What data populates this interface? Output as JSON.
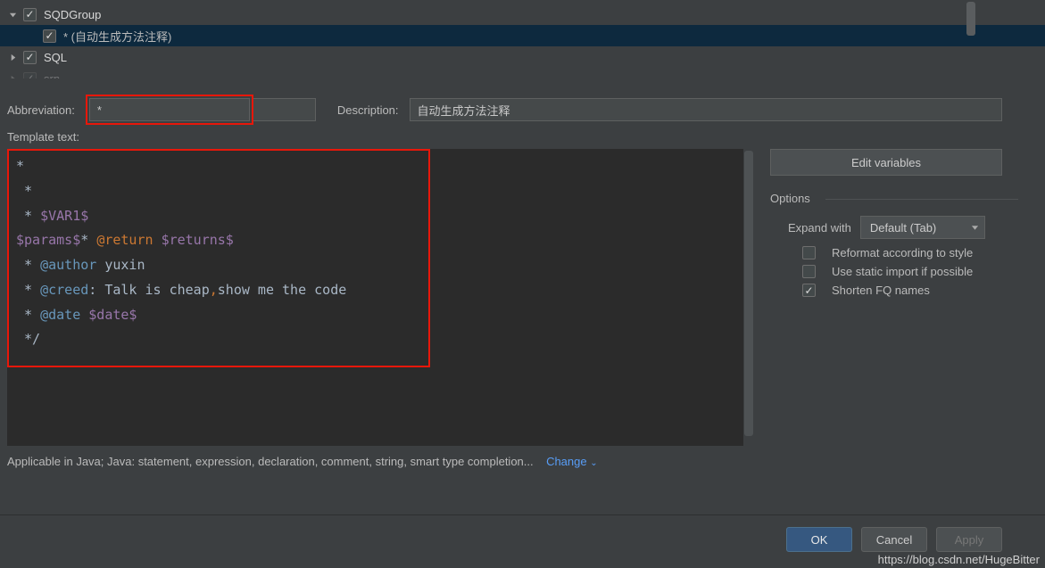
{
  "tree": {
    "group": "SQDGroup",
    "child": "* (自动生成方法注释)",
    "next": "SQL",
    "partial": "srn"
  },
  "form": {
    "abbrev_label": "Abbreviation:",
    "abbrev_value": "*",
    "desc_label": "Description:",
    "desc_value": "自动生成方法注释",
    "template_label": "Template text:"
  },
  "code": {
    "l1": "*",
    "l2": " *",
    "l3a": " * ",
    "l3b": "$VAR1$",
    "l4a": "$params$",
    "l4b": "* ",
    "l4c": "@return ",
    "l4d": "$returns$",
    "l5a": " * ",
    "l5b": "@author ",
    "l5c": "yuxin",
    "l6a": " * ",
    "l6b": "@creed",
    "l6c": ": Talk is cheap",
    "l6d": ",",
    "l6e": "show me the code",
    "l7a": " * ",
    "l7b": "@date ",
    "l7c": "$date$",
    "l8": " */"
  },
  "side": {
    "edit_vars": "Edit variables",
    "options_title": "Options",
    "expand_with": "Expand with",
    "expand_value": "Default (Tab)",
    "reformat": "Reformat according to style",
    "static_import": "Use static import if possible",
    "shorten_fq": "Shorten FQ names"
  },
  "applicable": {
    "text": "Applicable in Java; Java: statement, expression, declaration, comment, string, smart type completion...",
    "change": "Change"
  },
  "buttons": {
    "ok": "OK",
    "cancel": "Cancel",
    "apply": "Apply"
  },
  "watermark": "https://blog.csdn.net/HugeBitter"
}
